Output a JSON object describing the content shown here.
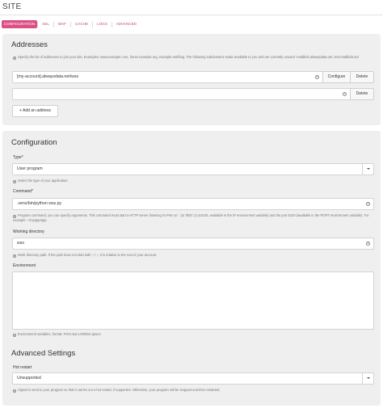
{
  "page": {
    "title": "SITE"
  },
  "tabs": [
    {
      "label": "CONFIGURATION",
      "active": true
    },
    {
      "label": "SSL"
    },
    {
      "label": "WAF"
    },
    {
      "label": "CACHE"
    },
    {
      "label": "LOGS"
    },
    {
      "label": "ADVANCED"
    }
  ],
  "addresses": {
    "title": "Addresses",
    "help": "Specify the list of addresses to join your site. Examples: www.example.com, forum.example.org, example.net/blog. The following subdomains make available to you and are currently unused: madblob.alwaysdata.net, test.madblob.net",
    "rows": [
      {
        "value": "[my-account].alwaysdata.net/wss",
        "configure_label": "Configure",
        "delete_label": "Delete"
      },
      {
        "value": "",
        "delete_label": "Delete"
      }
    ],
    "add_label": "+ Add an address"
  },
  "configuration": {
    "title": "Configuration",
    "type": {
      "label": "Type*",
      "value": "User program",
      "help": "Select the type of your application."
    },
    "command": {
      "label": "Command*",
      "value": ".venv/bin/python wss.py",
      "help": "Program command, you can specify arguments. This command must start a HTTP server listening in IPv6 on :: (or fd00::1) a:8100, available in the IP environment variable) and the port 8100 (available in the PORT environment variable). For example: ~/myapp/app"
    },
    "working_directory": {
      "label": "Working directory",
      "value": "wss",
      "help": "Work directory path. If the path does not start with ~ / ~, it is relative to the root of your account."
    },
    "environment": {
      "label": "Environment",
      "value": "",
      "help": "Environment variables, format: FOO=bar LOREM=ipsum"
    }
  },
  "advanced": {
    "title": "Advanced Settings",
    "hot_restart": {
      "label": "Hot restart",
      "value": "Unsupported",
      "help": "Signal to send to your program so that it carries out a hot restart, if supported. Otherwise, your program will be stopped and then restarted."
    }
  },
  "colors": {
    "accent": "#dc4f85",
    "tab_link": "#c14872",
    "panel": "#efefef"
  },
  "icons": {
    "clear": "clear-circle-icon",
    "help": "question-circle-icon",
    "dropdown": "chevron-down-icon"
  }
}
